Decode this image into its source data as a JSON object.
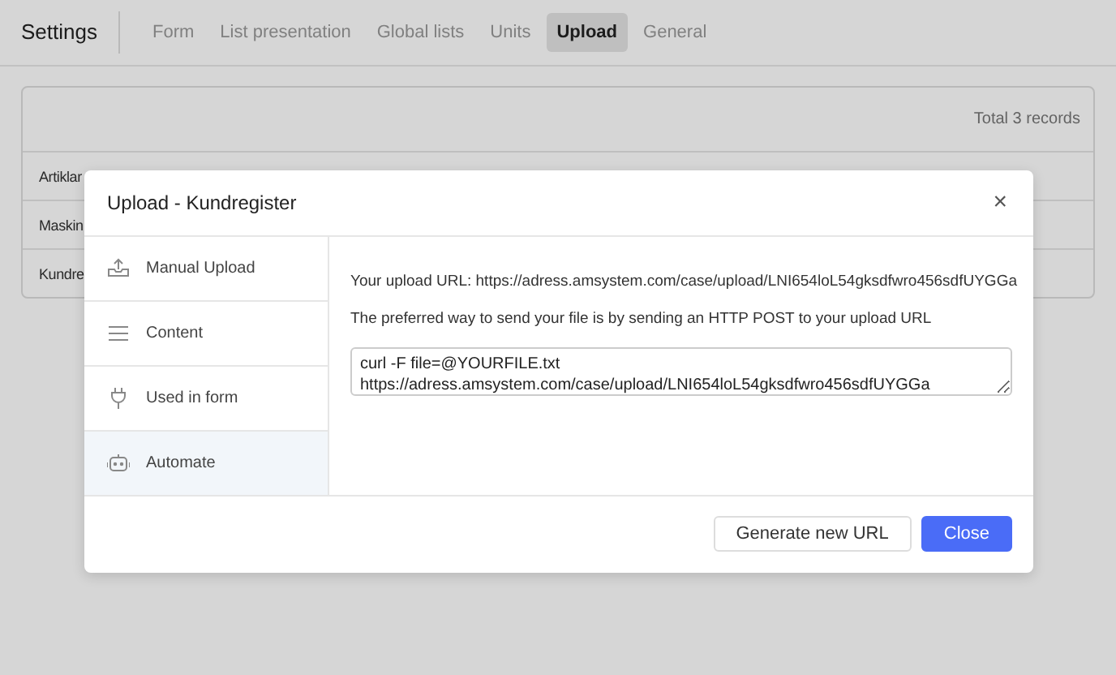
{
  "header": {
    "title": "Settings",
    "tabs": [
      {
        "label": "Form",
        "selected": false
      },
      {
        "label": "List presentation",
        "selected": false
      },
      {
        "label": "Global lists",
        "selected": false
      },
      {
        "label": "Units",
        "selected": false
      },
      {
        "label": "Upload",
        "selected": true
      },
      {
        "label": "General",
        "selected": false
      }
    ]
  },
  "records": {
    "total": "Total 3 records",
    "rows": [
      "Artiklar",
      "Maskin",
      "Kundre"
    ]
  },
  "dialog": {
    "title": "Upload - Kundregister",
    "close": "×",
    "menu": [
      {
        "label": "Manual Upload",
        "kind": "upload",
        "selected": false
      },
      {
        "label": "Content",
        "kind": "list",
        "selected": false
      },
      {
        "label": "Used in form",
        "kind": "plug",
        "selected": false
      },
      {
        "label": "Automate",
        "kind": "robot",
        "selected": true
      }
    ],
    "url_line": "Your upload URL: https://adress.amsystem.com/case/upload/LNI654loL54gksdfwro456sdfUYGGa",
    "hint": "The preferred way to send your file is by sending an HTTP POST to your upload URL",
    "command": "curl -F file=@YOURFILE.txt https://adress.amsystem.com/case/upload/LNI654loL54gksdfwro456sdfUYGGa",
    "buttons": [
      {
        "label": "Generate new URL",
        "kind": "secondary"
      },
      {
        "label": "Close",
        "kind": "primary"
      }
    ]
  }
}
